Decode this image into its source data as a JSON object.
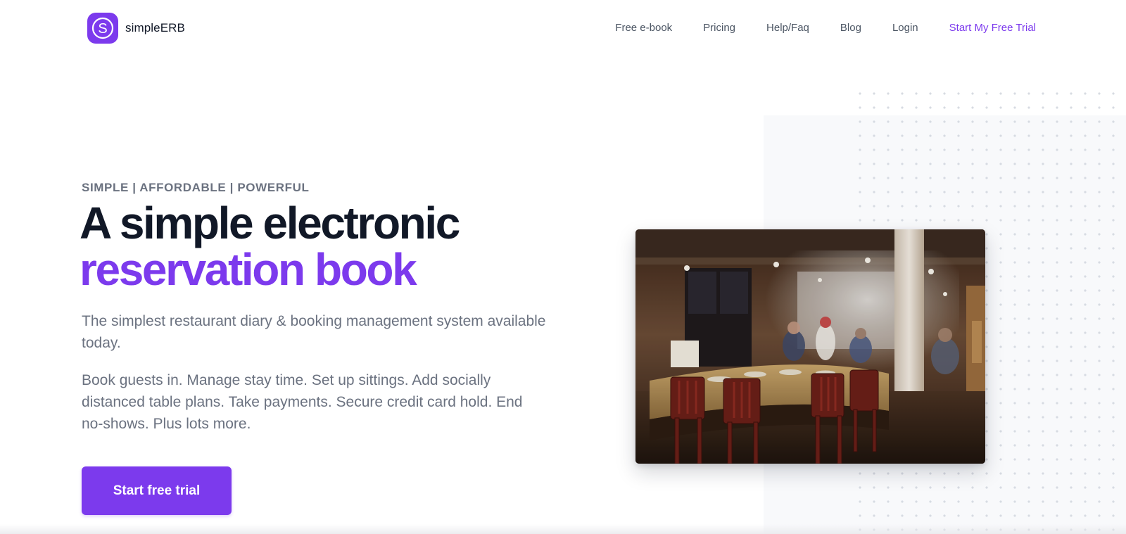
{
  "brand": {
    "name": "simpleERB",
    "logo_letter": "S",
    "accent_color": "#7c3aed"
  },
  "nav": {
    "items": [
      {
        "label": "Free e-book"
      },
      {
        "label": "Pricing"
      },
      {
        "label": "Help/Faq"
      },
      {
        "label": "Blog"
      },
      {
        "label": "Login"
      },
      {
        "label": "Start My Free Trial"
      }
    ]
  },
  "hero": {
    "eyebrow": "SIMPLE | AFFORDABLE | POWERFUL",
    "headline_line1": "A simple electronic",
    "headline_line2": "reservation book",
    "lead": "The simplest restaurant diary & booking management system available today.",
    "body": "Book guests in. Manage stay time. Set up sittings. Add socially distanced table plans. Take payments. Secure credit card hold. End no-shows. Plus lots more.",
    "cta_label": "Start free trial",
    "image_subject": "restaurant-interior-photo"
  }
}
